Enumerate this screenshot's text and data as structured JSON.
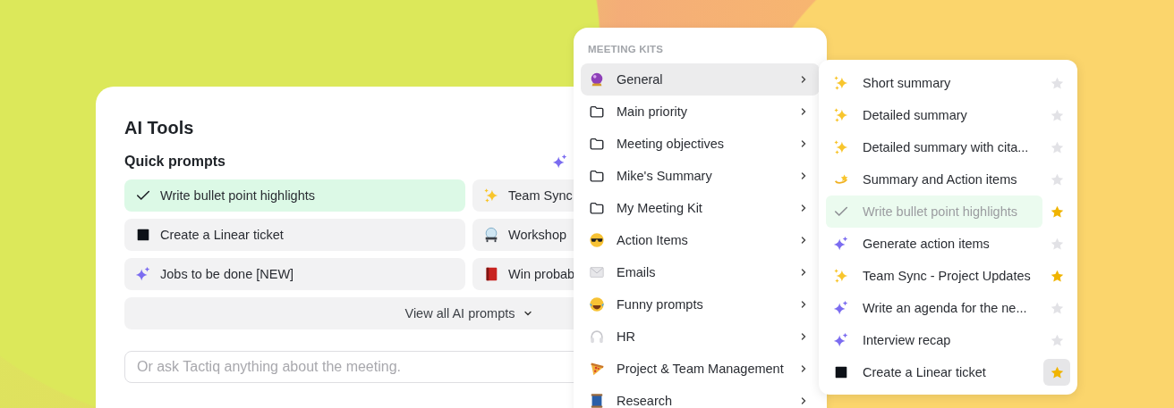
{
  "card": {
    "title": "AI Tools",
    "section_title": "Quick prompts",
    "quick_prompts": [
      {
        "label": "Write bullet point highlights",
        "kind": "check",
        "selected": true
      },
      {
        "label": "Team Sync",
        "kind": "sparkles",
        "selected": false
      },
      {
        "label": "Create a Linear ticket",
        "kind": "square",
        "selected": false
      },
      {
        "label": "Workshop",
        "kind": "globe",
        "selected": false
      },
      {
        "label": "Jobs to be done [NEW]",
        "kind": "sparkle",
        "selected": false
      },
      {
        "label": "Win probab",
        "kind": "book",
        "selected": false
      }
    ],
    "view_all": "View all AI prompts",
    "ask_placeholder": "Or ask Tactiq anything about the meeting."
  },
  "menu": {
    "header": "MEETING KITS",
    "items": [
      {
        "label": "General",
        "kind": "crystal-ball",
        "selected": true
      },
      {
        "label": "Main priority",
        "kind": "folder",
        "selected": false
      },
      {
        "label": "Meeting objectives",
        "kind": "folder",
        "selected": false
      },
      {
        "label": "Mike's Summary",
        "kind": "folder",
        "selected": false
      },
      {
        "label": "My Meeting Kit",
        "kind": "folder",
        "selected": false
      },
      {
        "label": "Action Items",
        "kind": "sunglasses",
        "selected": false
      },
      {
        "label": "Emails",
        "kind": "envelope",
        "selected": false
      },
      {
        "label": "Funny prompts",
        "kind": "laughing",
        "selected": false
      },
      {
        "label": "HR",
        "kind": "headphones",
        "selected": false
      },
      {
        "label": "Project & Team Management",
        "kind": "pizza",
        "selected": false
      },
      {
        "label": "Research",
        "kind": "spool",
        "selected": false
      }
    ]
  },
  "submenu": {
    "items": [
      {
        "label": "Short summary",
        "kind": "sparkles",
        "selected": false,
        "starred": false,
        "hovered": false
      },
      {
        "label": "Detailed summary",
        "kind": "sparkles",
        "selected": false,
        "starred": false,
        "hovered": false
      },
      {
        "label": "Detailed summary with cita...",
        "kind": "sparkles",
        "selected": false,
        "starred": false,
        "hovered": false
      },
      {
        "label": "Summary and Action items",
        "kind": "shooting-star",
        "selected": false,
        "starred": false,
        "hovered": false
      },
      {
        "label": "Write bullet point highlights",
        "kind": "check",
        "selected": true,
        "starred": true,
        "hovered": false
      },
      {
        "label": "Generate action items",
        "kind": "sparkle",
        "selected": false,
        "starred": false,
        "hovered": false
      },
      {
        "label": "Team Sync - Project Updates",
        "kind": "sparkles",
        "selected": false,
        "starred": true,
        "hovered": false
      },
      {
        "label": "Write an agenda for the ne...",
        "kind": "sparkle",
        "selected": false,
        "starred": false,
        "hovered": false
      },
      {
        "label": "Interview recap",
        "kind": "sparkle",
        "selected": false,
        "starred": false,
        "hovered": false
      },
      {
        "label": "Create a Linear ticket",
        "kind": "square",
        "selected": false,
        "starred": true,
        "hovered": true
      }
    ]
  }
}
